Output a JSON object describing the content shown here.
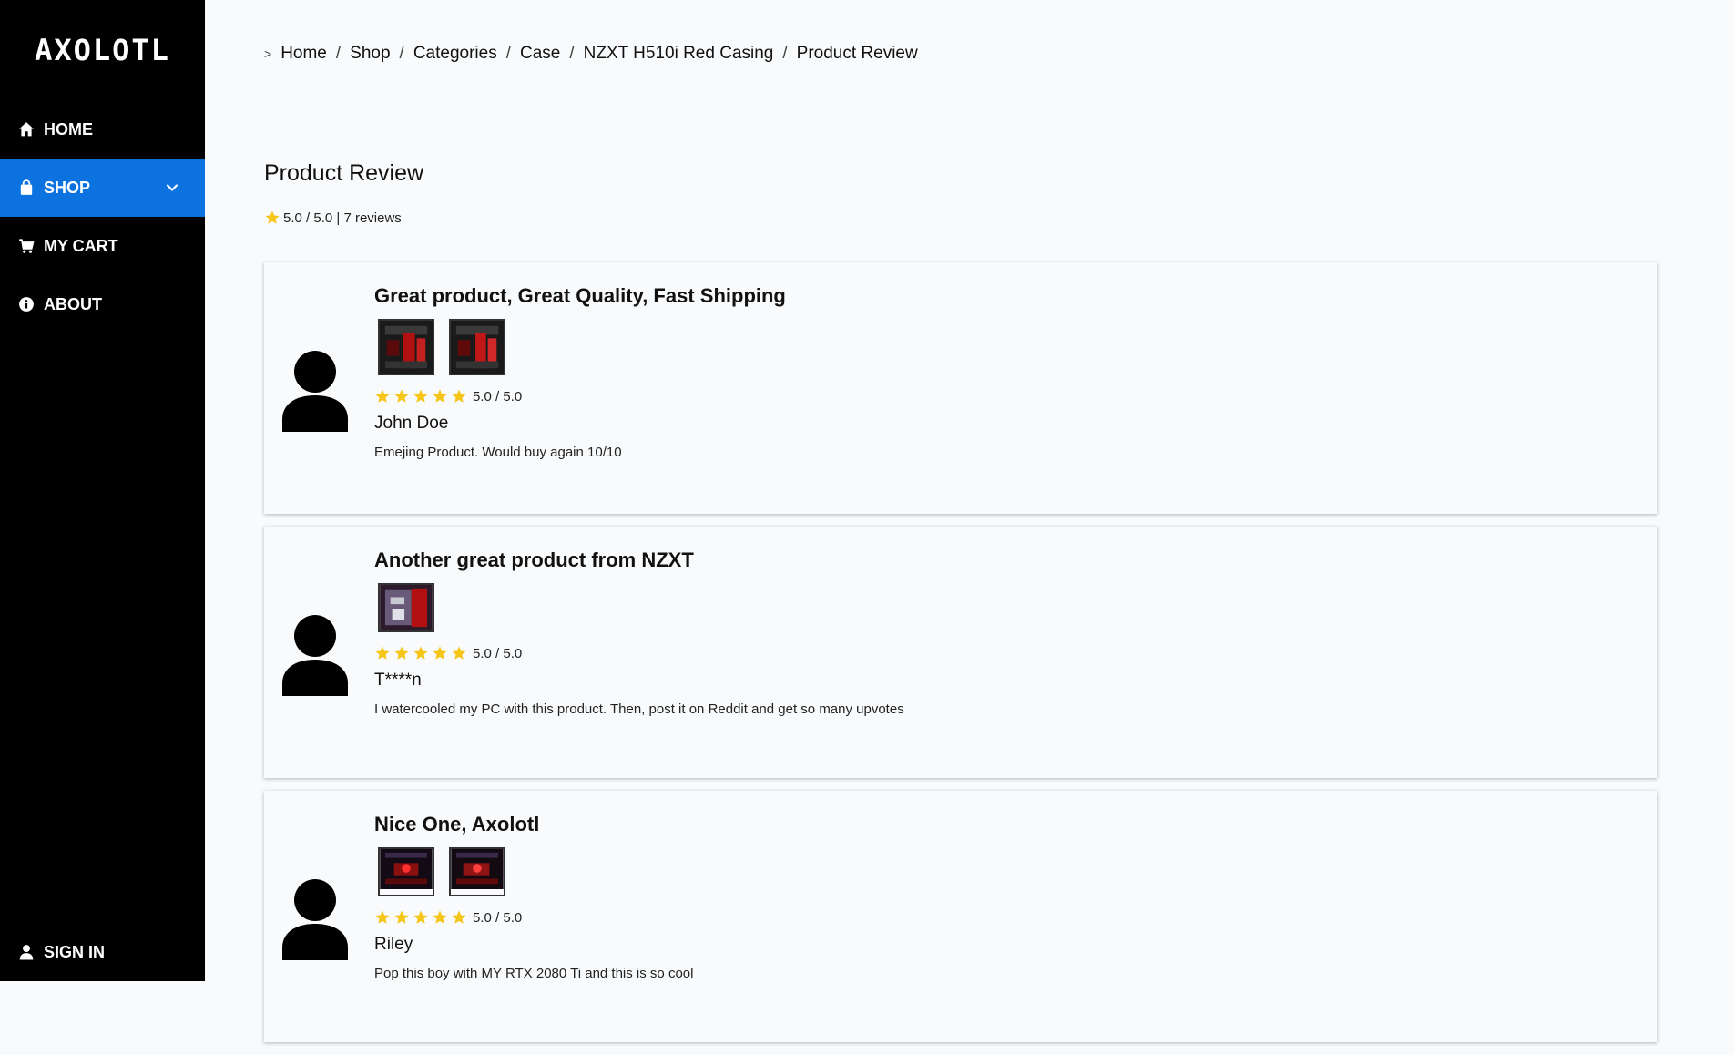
{
  "sidebar": {
    "logo": "AXOLOTL",
    "items": [
      {
        "label": "HOME",
        "icon": "home-icon"
      },
      {
        "label": "SHOP",
        "icon": "shopping-bag-icon"
      },
      {
        "label": "MY CART",
        "icon": "cart-icon"
      },
      {
        "label": "ABOUT",
        "icon": "info-icon"
      }
    ],
    "signin": "SIGN IN",
    "active_color": "#0b72e0"
  },
  "breadcrumb": {
    "caret": ">",
    "items": [
      "Home",
      "Shop",
      "Categories",
      "Case",
      "NZXT H510i Red Casing",
      "Product Review"
    ]
  },
  "page": {
    "title": "Product Review",
    "summary_rating": "5.0 / 5.0",
    "summary_reviews": "7 reviews"
  },
  "reviews": [
    {
      "title": "Great product, Great Quality, Fast Shipping",
      "rating": 5,
      "rating_text": "5.0 / 5.0",
      "reviewer": "John Doe",
      "comment": "Emejing Product. Would buy again 10/10"
    },
    {
      "title": "Another great product from NZXT",
      "rating": 5,
      "rating_text": "5.0 / 5.0",
      "reviewer": "T****n",
      "comment": "I watercooled my PC with this product. Then, post it on Reddit and get so many upvotes"
    },
    {
      "title": "Nice One, Axolotl",
      "rating": 5,
      "rating_text": "5.0 / 5.0",
      "reviewer": "Riley",
      "comment": "Pop this boy with MY RTX 2080 Ti and this is so cool"
    }
  ],
  "colors": {
    "star": "#f5c518",
    "sidebar_bg": "#000000",
    "page_bg": "#f8fafc"
  }
}
